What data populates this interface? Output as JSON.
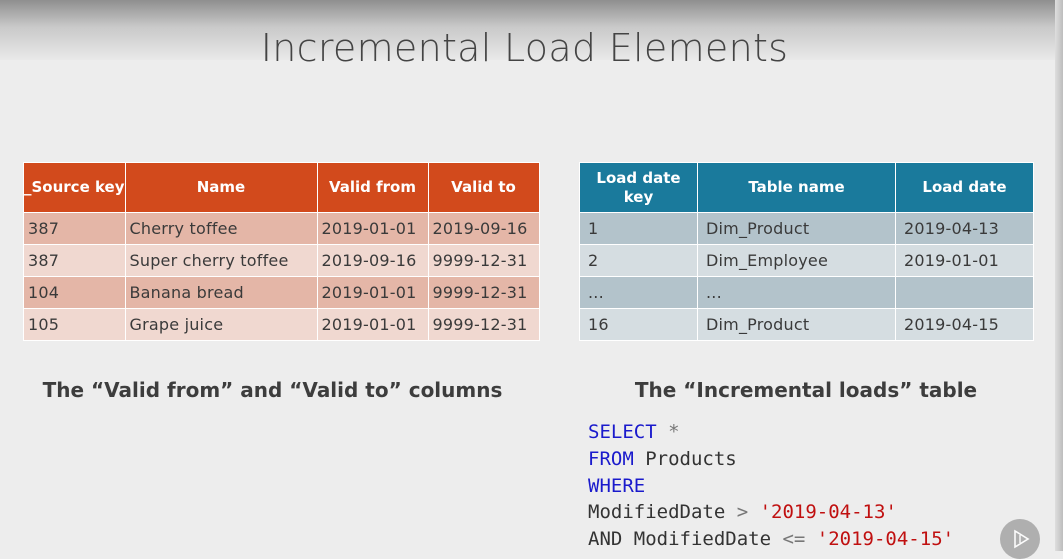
{
  "slide": {
    "title": "Incremental Load Elements"
  },
  "left_table": {
    "headers": [
      "_Source key",
      "Name",
      "Valid from",
      "Valid to"
    ],
    "rows": [
      [
        "387",
        "Cherry toffee",
        "2019-01-01",
        "2019-09-16"
      ],
      [
        "387",
        "Super cherry toffee",
        "2019-09-16",
        "9999-12-31"
      ],
      [
        "104",
        "Banana bread",
        "2019-01-01",
        "9999-12-31"
      ],
      [
        "105",
        "Grape juice",
        "2019-01-01",
        "9999-12-31"
      ]
    ],
    "caption": "The “Valid from” and “Valid to” columns"
  },
  "right_table": {
    "headers": [
      "Load date key",
      "Table name",
      "Load date"
    ],
    "rows": [
      [
        "1",
        "Dim_Product",
        "2019-04-13"
      ],
      [
        "2",
        "Dim_Employee",
        "2019-01-01"
      ],
      [
        "...",
        "...",
        ""
      ],
      [
        "16",
        "Dim_Product",
        "2019-04-15"
      ]
    ],
    "caption": "The “Incremental loads” table"
  },
  "code": {
    "select_kw": "SELECT",
    "select_rest": " *",
    "from_kw": "FROM",
    "from_rest": " Products",
    "where_kw": "WHERE",
    "line4_col": "ModifiedDate ",
    "line4_op": ">",
    "line4_val": " '2019-04-13'",
    "line5_and": "AND ModifiedDate ",
    "line5_op": "<=",
    "line5_val": " '2019-04-15'"
  },
  "colors": {
    "left_header": "#d24a1c",
    "right_header": "#1a7a9c",
    "sql_keyword": "#1a1acc",
    "sql_string": "#c01010"
  },
  "icons": {
    "player": "play-icon"
  }
}
